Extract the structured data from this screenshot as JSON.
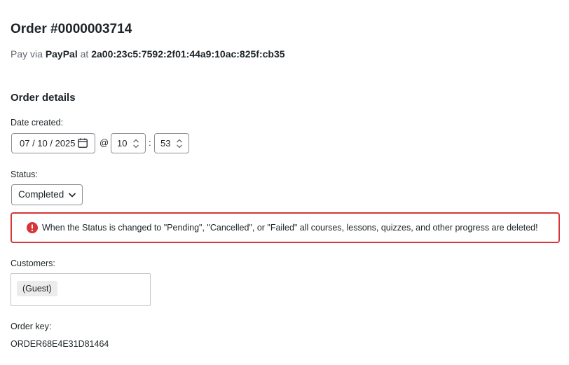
{
  "order": {
    "title": "Order #0000003714",
    "pay_prefix": "Pay via",
    "payment_method": "PayPal",
    "at_word": "at",
    "ip_address": "2a00:23c5:7592:2f01:44a9:10ac:825f:cb35"
  },
  "details": {
    "section_title": "Order details",
    "date_label": "Date created:",
    "date_value": "07 / 10 / 2025",
    "at_symbol": "@",
    "hour_value": "10",
    "time_separator": ":",
    "minute_value": "53",
    "status_label": "Status:",
    "status_value": "Completed",
    "warning_text": "When the Status is changed to \"Pending\", \"Cancelled\", or \"Failed\" all courses, lessons, quizzes, and other progress are deleted!",
    "customers_label": "Customers:",
    "customer_chip": "(Guest)",
    "order_key_label": "Order key:",
    "order_key_value": "ORDER68E4E31D81464"
  },
  "colors": {
    "error": "#d63638",
    "border": "#8c8f94",
    "text": "#1d2327",
    "muted": "#646970"
  },
  "icons": {
    "calendar": "calendar-icon",
    "spinner": "spinner-arrows-icon",
    "dropdown": "chevron-down-icon",
    "alert": "error-circle-icon"
  }
}
